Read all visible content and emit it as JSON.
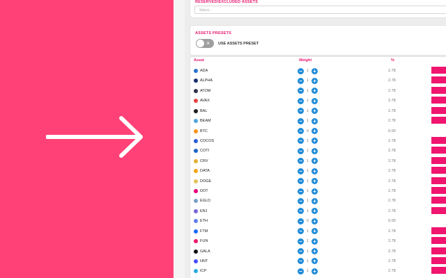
{
  "excluded": {
    "title": "RESERVED/EXCLUDED ASSETS",
    "placeholder": "Select..."
  },
  "presets": {
    "title": "ASSETS PRESETS",
    "toggle_label": "USE ASSETS PRESET",
    "toggle_on": false
  },
  "table": {
    "headers": {
      "asset": "Asset",
      "weight": "Weight",
      "pct": "%"
    },
    "rows": [
      {
        "asset": "ADA",
        "weight": "1",
        "pct": "2.78",
        "icon_color": "#2a71d0",
        "bar": 1
      },
      {
        "asset": "ALPHA",
        "weight": "1",
        "pct": "2.78",
        "icon_color": "#1b2f6e",
        "bar": 1
      },
      {
        "asset": "ATOM",
        "weight": "1",
        "pct": "2.78",
        "icon_color": "#2e3148",
        "bar": 1
      },
      {
        "asset": "AVAX",
        "weight": "1",
        "pct": "2.78",
        "icon_color": "#e84142",
        "bar": 1
      },
      {
        "asset": "BAL",
        "weight": "1",
        "pct": "2.78",
        "icon_color": "#1e1e1e",
        "bar": 1
      },
      {
        "asset": "BEAM",
        "weight": "1",
        "pct": "2.78",
        "icon_color": "#4fa5e0",
        "bar": 1
      },
      {
        "asset": "BTC",
        "weight": "0",
        "pct": "0.00",
        "icon_color": "#f7931a",
        "bar": 0
      },
      {
        "asset": "COCOS",
        "weight": "1",
        "pct": "2.78",
        "icon_color": "#2a5bd7",
        "bar": 1
      },
      {
        "asset": "COTI",
        "weight": "1",
        "pct": "2.78",
        "icon_color": "#1b64c8",
        "bar": 1
      },
      {
        "asset": "CRV",
        "weight": "1",
        "pct": "2.78",
        "icon_color": "#e3b033",
        "bar": 1
      },
      {
        "asset": "DATA",
        "weight": "1",
        "pct": "2.78",
        "icon_color": "#f4a416",
        "bar": 1
      },
      {
        "asset": "DOGE",
        "weight": "1",
        "pct": "2.78",
        "icon_color": "#e1c15a",
        "bar": 1
      },
      {
        "asset": "DOT",
        "weight": "1",
        "pct": "2.78",
        "icon_color": "#e6007a",
        "bar": 1
      },
      {
        "asset": "EGLD",
        "weight": "1",
        "pct": "2.78",
        "icon_color": "#7aa0c4",
        "bar": 1
      },
      {
        "asset": "ENJ",
        "weight": "1",
        "pct": "2.78",
        "icon_color": "#7866d5",
        "bar": 1
      },
      {
        "asset": "ETH",
        "weight": "0",
        "pct": "0.00",
        "icon_color": "#627eea",
        "bar": 0
      },
      {
        "asset": "FTM",
        "weight": "1",
        "pct": "2.78",
        "icon_color": "#1969ff",
        "bar": 1
      },
      {
        "asset": "FUN",
        "weight": "1",
        "pct": "2.78",
        "icon_color": "#ed1968",
        "bar": 1
      },
      {
        "asset": "GALA",
        "weight": "1",
        "pct": "2.78",
        "icon_color": "#111111",
        "bar": 1
      },
      {
        "asset": "HNT",
        "weight": "1",
        "pct": "2.78",
        "icon_color": "#474dff",
        "bar": 1
      },
      {
        "asset": "ICP",
        "weight": "1",
        "pct": "2.78",
        "icon_color": "#29abe2",
        "bar": 1
      }
    ]
  },
  "colors": {
    "left_panel": "#ff4177",
    "accent": "#e8156e",
    "button": "#1e8bd9",
    "bar": "#f0156f"
  }
}
